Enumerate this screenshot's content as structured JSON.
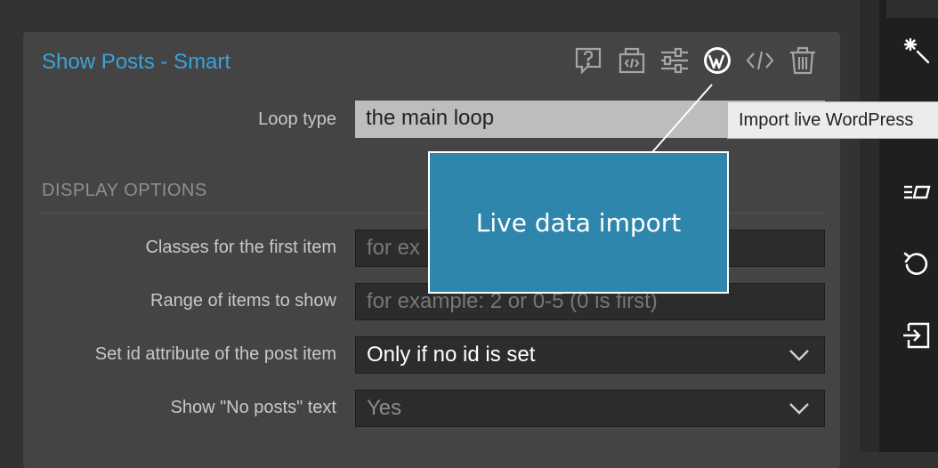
{
  "panel": {
    "title": "Show Posts - Smart",
    "toolbar_icons": [
      "help-icon",
      "module-icon",
      "settings-sliders-icon",
      "wordpress-icon",
      "code-icon",
      "trash-icon"
    ]
  },
  "loop_type": {
    "label": "Loop type",
    "value": "the main loop"
  },
  "tooltip": {
    "text": "Import live WordPress"
  },
  "callout": {
    "text": "Live data import"
  },
  "display_options": {
    "header": "DISPLAY OPTIONS",
    "first_item_classes": {
      "label": "Classes for the first item",
      "placeholder": "for ex"
    },
    "range_of_items": {
      "label": "Range of items to show",
      "placeholder": "for example: 2 or 0-5 (0 is first)"
    },
    "set_id_attribute": {
      "label": "Set id attribute of the post item",
      "value": "Only if no id is set"
    },
    "show_no_posts": {
      "label": "Show \"No posts\" text",
      "value": "Yes"
    }
  },
  "right_toolbar_icons": [
    "sparkle-icon",
    "structure-icon",
    "undo-icon",
    "import-icon"
  ],
  "colors": {
    "accent": "#3aa3d9",
    "callout_bg": "#2e86ad",
    "panel_bg": "#444444"
  }
}
